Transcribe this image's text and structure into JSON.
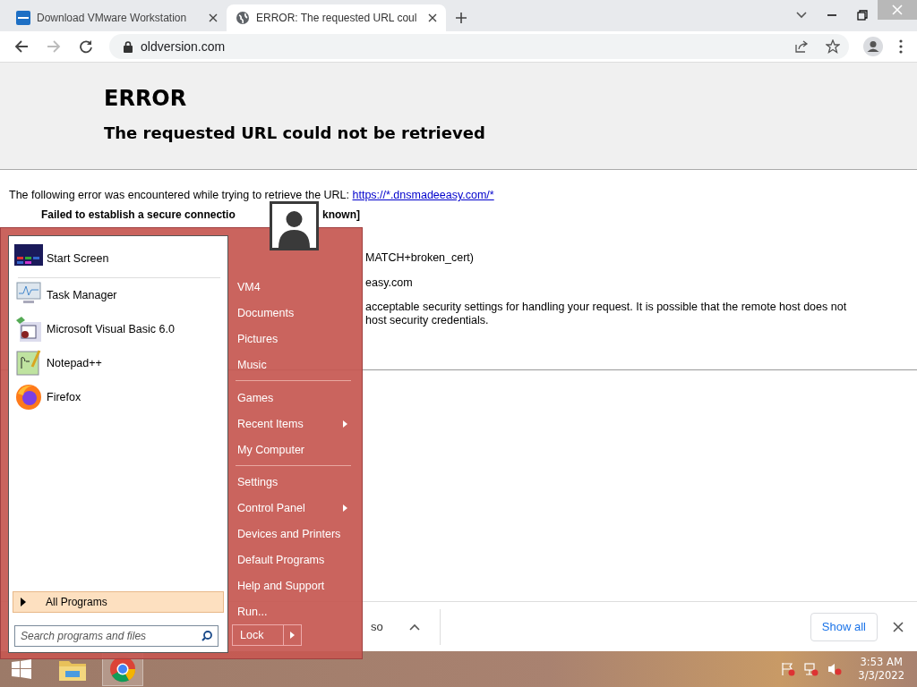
{
  "browser": {
    "tabs": [
      {
        "title": "Download VMware Workstation",
        "selected": false
      },
      {
        "title": "ERROR: The requested URL coul",
        "selected": true
      }
    ],
    "address": "oldversion.com"
  },
  "page": {
    "heading": "ERROR",
    "subheading": "The requested URL could not be retrieved",
    "intro": "The following error was encountered while trying to retrieve the URL: ",
    "url": "https://*.dnsmadeeasy.com/*",
    "fragments": [
      "Failed to establish a secure connectio",
      "known]",
      "MATCH+broken_cert)",
      "easy.com",
      "acceptable security settings for handling your request. It is possible that the remote host does not",
      "host security credentials."
    ]
  },
  "downloads": {
    "item": "so",
    "show_all": "Show all"
  },
  "start_menu": {
    "programs": [
      [
        {
          "name": "Start Screen"
        }
      ],
      [
        {
          "name": "Task Manager"
        },
        {
          "name": "Microsoft Visual Basic 6.0"
        },
        {
          "name": "Notepad++"
        },
        {
          "name": "Firefox"
        }
      ]
    ],
    "all_programs": "All Programs",
    "search_placeholder": "Search programs and files",
    "places": [
      [
        {
          "label": "VM4",
          "submenu": false
        },
        {
          "label": "Documents",
          "submenu": false
        },
        {
          "label": "Pictures",
          "submenu": false
        },
        {
          "label": "Music",
          "submenu": false
        }
      ],
      [
        {
          "label": "Games",
          "submenu": false
        },
        {
          "label": "Recent Items",
          "submenu": true
        },
        {
          "label": "My Computer",
          "submenu": false
        }
      ],
      [
        {
          "label": "Settings",
          "submenu": false
        },
        {
          "label": "Control Panel",
          "submenu": true
        },
        {
          "label": "Devices and Printers",
          "submenu": false
        },
        {
          "label": "Default Programs",
          "submenu": false
        },
        {
          "label": "Help and Support",
          "submenu": false
        },
        {
          "label": "Run...",
          "submenu": false
        }
      ]
    ],
    "power": "Lock"
  },
  "taskbar": {
    "apps": [
      {
        "kind": "explorer",
        "selected": false
      },
      {
        "kind": "chrome",
        "selected": true
      }
    ],
    "time": "3:53 AM",
    "date": "3/3/2022"
  }
}
